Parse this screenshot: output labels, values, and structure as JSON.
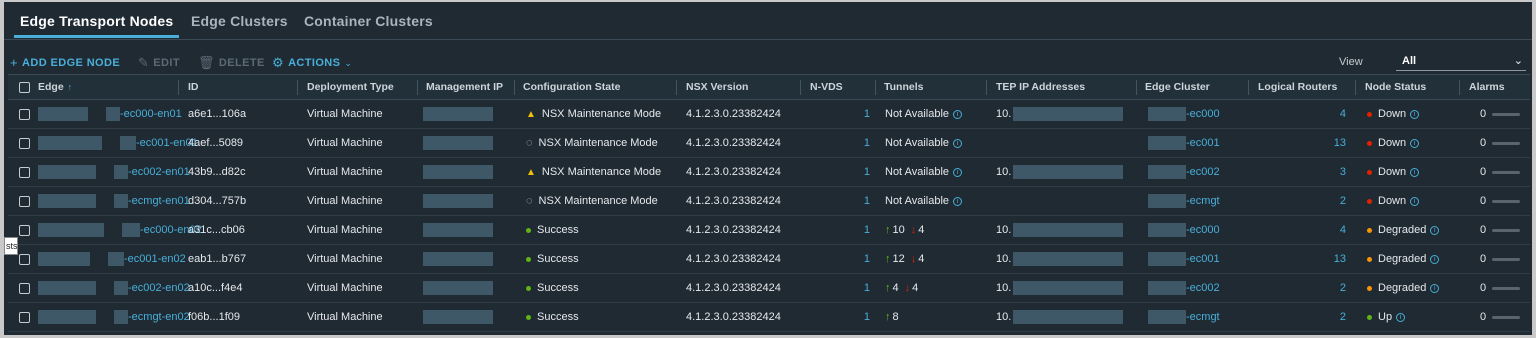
{
  "tabs": [
    {
      "label": "Edge Transport Nodes",
      "active": true
    },
    {
      "label": "Edge Clusters",
      "active": false
    },
    {
      "label": "Container Clusters",
      "active": false
    }
  ],
  "toolbar": {
    "add_label": "ADD EDGE NODE",
    "edit_label": "EDIT",
    "delete_label": "DELETE",
    "actions_label": "ACTIONS",
    "view_label": "View",
    "view_value": "All"
  },
  "columns": {
    "edge": "Edge",
    "id": "ID",
    "deployment": "Deployment Type",
    "mgmt_ip": "Management IP",
    "config_state": "Configuration State",
    "nsx_version": "NSX Version",
    "nvds": "N-VDS",
    "tunnels": "Tunnels",
    "tep": "TEP IP Addresses",
    "edge_cluster": "Edge Cluster",
    "logical_routers": "Logical Routers",
    "node_status": "Node Status",
    "alarms": "Alarms"
  },
  "rows": [
    {
      "edge": "-ec000-en01",
      "id": "a6e1...106a",
      "deployment": "Virtual Machine",
      "config_state": "NSX Maintenance Mode",
      "config_icon": "warning-icon",
      "nsx_version": "4.1.2.3.0.23382424",
      "nvds": "1",
      "tunnels_text": "Not Available",
      "tunnels_up": "",
      "tunnels_down": "",
      "tep": "10.",
      "edge_cluster": "-ec000",
      "logical_routers": "4",
      "node_status": "Down",
      "status_color": "#e12200",
      "alarms": "0"
    },
    {
      "edge": "-ec001-en01",
      "id": "4aef...5089",
      "deployment": "Virtual Machine",
      "config_state": "NSX Maintenance Mode",
      "config_icon": "in-progress-icon",
      "nsx_version": "4.1.2.3.0.23382424",
      "nvds": "1",
      "tunnels_text": "Not Available",
      "tunnels_up": "",
      "tunnels_down": "",
      "tep": "",
      "edge_cluster": "-ec001",
      "logical_routers": "13",
      "node_status": "Down",
      "status_color": "#e12200",
      "alarms": "0"
    },
    {
      "edge": "-ec002-en01",
      "id": "43b9...d82c",
      "deployment": "Virtual Machine",
      "config_state": "NSX Maintenance Mode",
      "config_icon": "warning-icon",
      "nsx_version": "4.1.2.3.0.23382424",
      "nvds": "1",
      "tunnels_text": "Not Available",
      "tunnels_up": "",
      "tunnels_down": "",
      "tep": "10.",
      "edge_cluster": "-ec002",
      "logical_routers": "3",
      "node_status": "Down",
      "status_color": "#e12200",
      "alarms": "0"
    },
    {
      "edge": "-ecmgt-en01",
      "id": "d304...757b",
      "deployment": "Virtual Machine",
      "config_state": "NSX Maintenance Mode",
      "config_icon": "in-progress-icon",
      "nsx_version": "4.1.2.3.0.23382424",
      "nvds": "1",
      "tunnels_text": "Not Available",
      "tunnels_up": "",
      "tunnels_down": "",
      "tep": "",
      "edge_cluster": "-ecmgt",
      "logical_routers": "2",
      "node_status": "Down",
      "status_color": "#e12200",
      "alarms": "0"
    },
    {
      "edge": "-ec000-en02",
      "id": "a31c...cb06",
      "deployment": "Virtual Machine",
      "config_state": "Success",
      "config_icon": "success-dot",
      "nsx_version": "4.1.2.3.0.23382424",
      "nvds": "1",
      "tunnels_text": "",
      "tunnels_up": "10",
      "tunnels_down": "4",
      "tep": "10.",
      "edge_cluster": "-ec000",
      "logical_routers": "4",
      "node_status": "Degraded",
      "status_color": "#f89406",
      "alarms": "0"
    },
    {
      "edge": "-ec001-en02",
      "id": "eab1...b767",
      "deployment": "Virtual Machine",
      "config_state": "Success",
      "config_icon": "success-dot",
      "nsx_version": "4.1.2.3.0.23382424",
      "nvds": "1",
      "tunnels_text": "",
      "tunnels_up": "12",
      "tunnels_down": "4",
      "tep": "10.",
      "edge_cluster": "-ec001",
      "logical_routers": "13",
      "node_status": "Degraded",
      "status_color": "#f89406",
      "alarms": "0"
    },
    {
      "edge": "-ec002-en02",
      "id": "a10c...f4e4",
      "deployment": "Virtual Machine",
      "config_state": "Success",
      "config_icon": "success-dot",
      "nsx_version": "4.1.2.3.0.23382424",
      "nvds": "1",
      "tunnels_text": "",
      "tunnels_up": "4",
      "tunnels_down": "4",
      "tep": "10.",
      "edge_cluster": "-ec002",
      "logical_routers": "2",
      "node_status": "Degraded",
      "status_color": "#f89406",
      "alarms": "0"
    },
    {
      "edge": "-ecmgt-en02",
      "id": "f06b...1f09",
      "deployment": "Virtual Machine",
      "config_state": "Success",
      "config_icon": "success-dot",
      "nsx_version": "4.1.2.3.0.23382424",
      "nvds": "1",
      "tunnels_text": "",
      "tunnels_up": "8",
      "tunnels_down": "",
      "tep": "10.",
      "edge_cluster": "-ecmgt",
      "logical_routers": "2",
      "node_status": "Up",
      "status_color": "#60b515",
      "alarms": "0"
    }
  ],
  "tooltip_fragment": "sts",
  "colors": {
    "accent": "#49afd9",
    "background": "#1f2a33",
    "down": "#e12200",
    "degraded": "#f89406",
    "up": "#60b515",
    "warning": "#efc006"
  }
}
